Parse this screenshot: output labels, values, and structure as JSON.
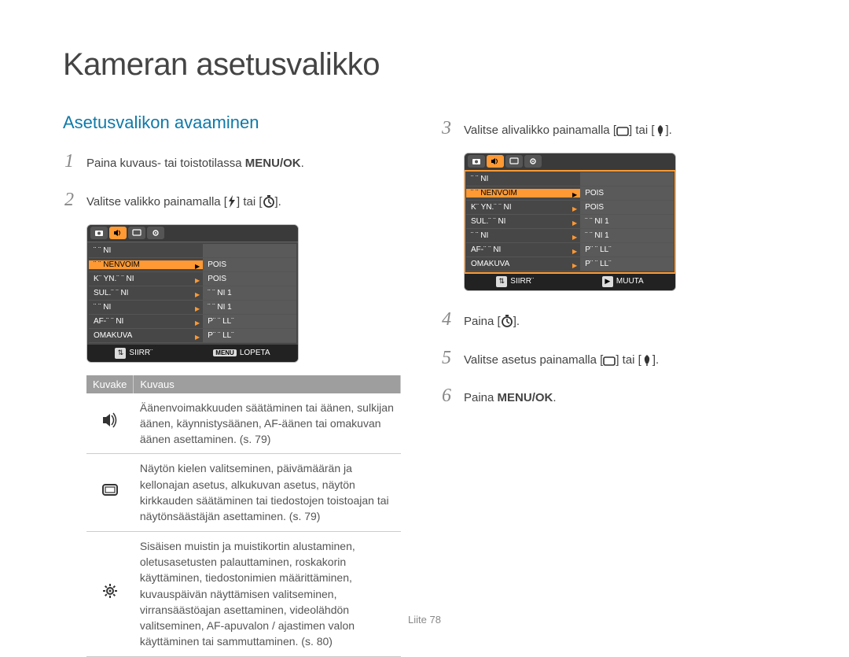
{
  "title": "Kameran asetusvalikko",
  "section_heading": "Asetusvalikon avaaminen",
  "steps_left": {
    "s1_pre": "Paina kuvaus- tai toistotilassa ",
    "s1_bold": "MENU/OK",
    "s1_post": ".",
    "s2_pre": "Valitse valikko painamalla [",
    "s2_mid": "] tai [",
    "s2_post": "]."
  },
  "steps_right": {
    "s3_pre": "Valitse alivalikko painamalla [",
    "s3_mid": "] tai [",
    "s3_post": "].",
    "s4_pre": "Paina [",
    "s4_post": "].",
    "s5_pre": "Valitse asetus painamalla [",
    "s5_mid": "] tai [",
    "s5_post": "].",
    "s6_pre": "Paina ",
    "s6_bold": "MENU/OK",
    "s6_post": "."
  },
  "cam_screen_1": {
    "header_label": "¨ ¨ NI",
    "rows": [
      {
        "l": "¨ ¨ NENVOIM",
        "r": "POIS",
        "selected": true
      },
      {
        "l": "K¨ YN.¨ ¨ NI",
        "r": "POIS"
      },
      {
        "l": "SUL.¨ ¨ NI",
        "r": "¨ ¨ NI 1"
      },
      {
        "l": "¨ ¨ NI",
        "r": "¨ ¨ NI 1"
      },
      {
        "l": "AF-¨ ¨ NI",
        "r": "P¨ ¨ LL¨"
      },
      {
        "l": "OMAKUVA",
        "r": "P¨ ¨ LL¨"
      }
    ],
    "footer_left": "SIIRR¨",
    "footer_right_btn": "MENU",
    "footer_right": "LOPETA"
  },
  "cam_screen_2": {
    "header_label": "¨ ¨ NI",
    "rows": [
      {
        "l": "¨ ¨ NENVOIM",
        "r": "POIS",
        "selected": true
      },
      {
        "l": "K¨ YN.¨ ¨ NI",
        "r": "POIS"
      },
      {
        "l": "SUL.¨ ¨ NI",
        "r": "¨ ¨ NI 1"
      },
      {
        "l": "¨ ¨ NI",
        "r": "¨ ¨ NI 1"
      },
      {
        "l": "AF-¨ ¨ NI",
        "r": "P¨ ¨ LL¨"
      },
      {
        "l": "OMAKUVA",
        "r": "P¨ ¨ LL¨"
      }
    ],
    "footer_left": "SIIRR¨",
    "footer_right": "MUUTA"
  },
  "legend": {
    "header_icon": "Kuvake",
    "header_desc": "Kuvaus",
    "rows": [
      {
        "icon": "speaker",
        "desc": "Äänenvoimakkuuden säätäminen tai äänen, sulkijan äänen, käynnistysäänen, AF-äänen tai omakuvan äänen asettaminen. (s. 79)"
      },
      {
        "icon": "display",
        "desc": "Näytön kielen valitseminen, päivämäärän ja kellonajan asetus, alkukuvan asetus, näytön kirkkauden säätäminen tai tiedostojen toistoajan tai näytönsäästäjän asettaminen. (s. 79)"
      },
      {
        "icon": "gear",
        "desc": "Sisäisen muistin ja muistikortin alustaminen, oletusasetusten palauttaminen, roskakorin käyttäminen, tiedostonimien määrittäminen, kuvauspäivän näyttämisen valitseminen, virransäästöajan asettaminen, videolähdön valitseminen, AF-apuvalon / ajastimen valon käyttäminen tai sammuttaminen. (s. 80)"
      }
    ]
  },
  "nums": {
    "n1": "1",
    "n2": "2",
    "n3": "3",
    "n4": "4",
    "n5": "5",
    "n6": "6"
  },
  "footer": {
    "label": "Liite",
    "page": "78"
  }
}
